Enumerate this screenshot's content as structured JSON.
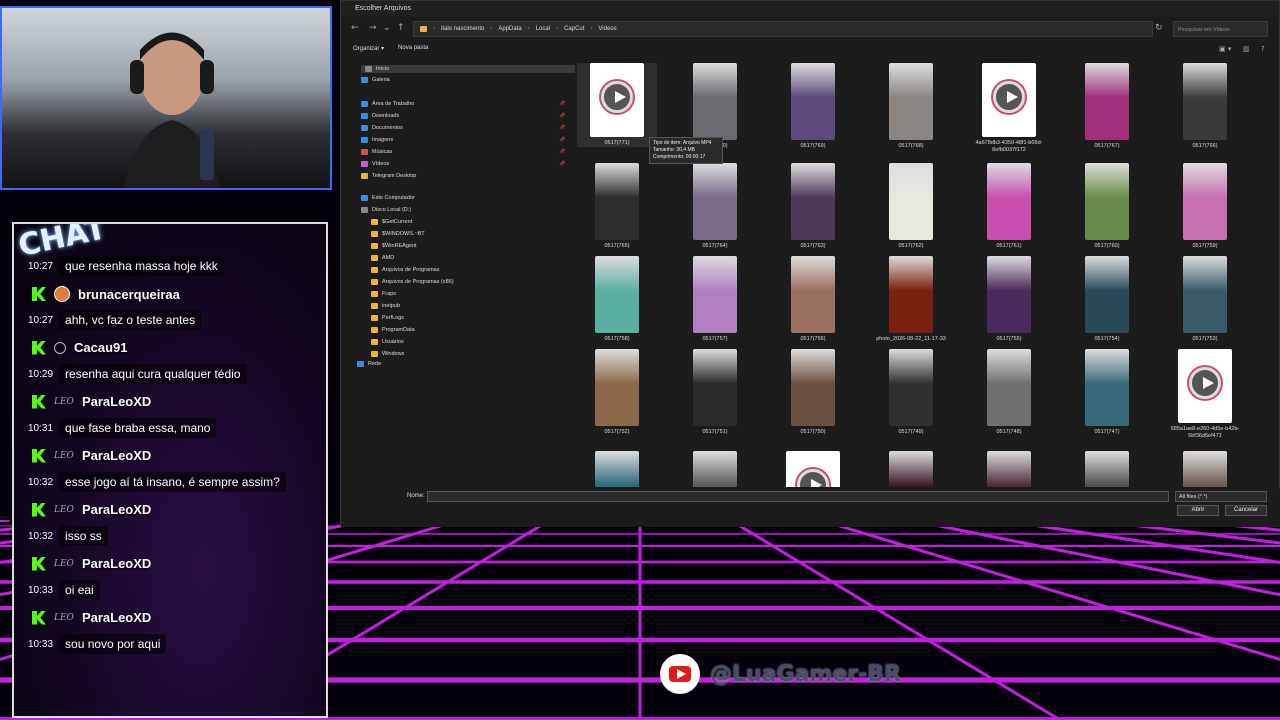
{
  "chat": {
    "badge": "CHAT",
    "messages": [
      {
        "time": "10:27",
        "text": "que resenha massa hoje kkk"
      },
      {
        "user": "brunacerqueiraa",
        "time": "10:27",
        "text": "ahh, vc faz o teste antes"
      },
      {
        "user": "Cacau91",
        "time": "10:29",
        "text": "resenha aqui cura qualquer tédio"
      },
      {
        "user": "ParaLeoXD",
        "tag": "LEO",
        "time": "10:31",
        "text": "que fase braba essa, mano"
      },
      {
        "user": "ParaLeoXD",
        "tag": "LEO",
        "time": "10:32",
        "text": "esse jogo aí tá insano, é sempre assim?"
      },
      {
        "user": "ParaLeoXD",
        "tag": "LEO",
        "time": "10:32",
        "text": "isso ss"
      },
      {
        "user": "ParaLeoXD",
        "tag": "LEO",
        "time": "10:33",
        "text": "oi eai"
      },
      {
        "user": "ParaLeoXD",
        "tag": "LEO",
        "time": "10:33",
        "text": "sou novo por aqui"
      }
    ]
  },
  "dialog": {
    "title": "Escolher Arquivos",
    "path": [
      "italo nascimento",
      "AppData",
      "Local",
      "CapCut",
      "Videos"
    ],
    "search_placeholder": "Pesquisar em Videos",
    "toolbar": {
      "organize": "Organizar ▾",
      "new_folder": "Nova pasta"
    },
    "nav": [
      {
        "label": "Início",
        "icon": "home-icon"
      },
      {
        "label": "Galeria",
        "icon": "gallery-icon"
      },
      {
        "label": "Área de Trabalho",
        "icon": "desktop-icon"
      },
      {
        "label": "Downloads",
        "icon": "download-icon"
      },
      {
        "label": "Documentos",
        "icon": "documents-icon"
      },
      {
        "label": "Imagens",
        "icon": "pictures-icon"
      },
      {
        "label": "Músicas",
        "icon": "music-icon"
      },
      {
        "label": "Vídeos",
        "icon": "videos-icon"
      },
      {
        "label": "Telegram Desktop",
        "icon": "folder-icon"
      },
      {
        "label": "Este Computador",
        "icon": "computer-icon"
      },
      {
        "label": "Disco Local (D:)",
        "icon": "drive-icon"
      },
      {
        "label": "$GetCurrent",
        "icon": "folder-icon"
      },
      {
        "label": "$WINDOWS.~BT",
        "icon": "folder-icon"
      },
      {
        "label": "$WinREAgent",
        "icon": "folder-icon"
      },
      {
        "label": "AMD",
        "icon": "folder-icon"
      },
      {
        "label": "Arquivos de Programas",
        "icon": "folder-icon"
      },
      {
        "label": "Arquivos de Programas (x86)",
        "icon": "folder-icon"
      },
      {
        "label": "Fraps",
        "icon": "folder-icon"
      },
      {
        "label": "inetpub",
        "icon": "folder-icon"
      },
      {
        "label": "PerfLogs",
        "icon": "folder-icon"
      },
      {
        "label": "ProgramData",
        "icon": "folder-icon"
      },
      {
        "label": "Usuários",
        "icon": "folder-icon"
      },
      {
        "label": "Windows",
        "icon": "folder-icon"
      },
      {
        "label": "Rede",
        "icon": "network-icon"
      }
    ],
    "files": [
      {
        "name": "0517(771)",
        "kind": "doc"
      },
      {
        "name": "0517(770)",
        "kind": "img",
        "color": "#6a6a70"
      },
      {
        "name": "0517(769)",
        "kind": "img",
        "color": "#5b4a7a"
      },
      {
        "name": "0517(768)",
        "kind": "img",
        "color": "#8a8580"
      },
      {
        "name": "4a678db3-4350-48f1-b09d-8efb0037f172",
        "kind": "doc"
      },
      {
        "name": "0517(767)",
        "kind": "img",
        "color": "#a0307a"
      },
      {
        "name": "0517(766)",
        "kind": "img",
        "color": "#3a3a3a"
      },
      {
        "name": "0517(765)",
        "kind": "img",
        "color": "#2c2c2c"
      },
      {
        "name": "0517(764)",
        "kind": "img",
        "color": "#7a6a8a"
      },
      {
        "name": "0517(763)",
        "kind": "img",
        "color": "#503a5a"
      },
      {
        "name": "0517(762)",
        "kind": "img",
        "color": "#e8e8e0"
      },
      {
        "name": "0517(761)",
        "kind": "img",
        "color": "#c84fb0"
      },
      {
        "name": "0517(760)",
        "kind": "img",
        "color": "#6a8a4a"
      },
      {
        "name": "0517(759)",
        "kind": "img",
        "color": "#c86fb0"
      },
      {
        "name": "0517(758)",
        "kind": "img",
        "color": "#5ab0a0"
      },
      {
        "name": "0517(757)",
        "kind": "img",
        "color": "#b080c0"
      },
      {
        "name": "0517(756)",
        "kind": "img",
        "color": "#9a7060"
      },
      {
        "name": "photo_2026-08-22_11-17-33",
        "kind": "img",
        "color": "#7a2010"
      },
      {
        "name": "0517(755)",
        "kind": "img",
        "color": "#4a2a5a"
      },
      {
        "name": "0517(754)",
        "kind": "img",
        "color": "#2a4a5a"
      },
      {
        "name": "0517(753)",
        "kind": "img",
        "color": "#3a5a6a"
      },
      {
        "name": "0517(752)",
        "kind": "img",
        "color": "#8a6a4a"
      },
      {
        "name": "0517(751)",
        "kind": "img",
        "color": "#2a2a2a"
      },
      {
        "name": "0517(750)",
        "kind": "img",
        "color": "#6a5040"
      },
      {
        "name": "0517(749)",
        "kind": "img",
        "color": "#303030"
      },
      {
        "name": "0517(748)",
        "kind": "img",
        "color": "#707070"
      },
      {
        "name": "0517(747)",
        "kind": "img",
        "color": "#3a6a7a"
      },
      {
        "name": "685a1ae8-e260-4d5e-b42b-5bf36d6ef471",
        "kind": "doc"
      },
      {
        "name": "",
        "kind": "img",
        "color": "#2a6a7a"
      },
      {
        "name": "",
        "kind": "img",
        "color": "#5a5a5a"
      },
      {
        "name": "",
        "kind": "doc"
      },
      {
        "name": "",
        "kind": "img",
        "color": "#3a1a2a"
      },
      {
        "name": "",
        "kind": "img",
        "color": "#4a2a3a"
      },
      {
        "name": "",
        "kind": "img",
        "color": "#505050"
      },
      {
        "name": "",
        "kind": "img",
        "color": "#6a5a50"
      }
    ],
    "tooltip": [
      "Tipo de item: Arquivo MP4",
      "Tamanho: 30,4 MB",
      "Comprimento: 00:00:17"
    ],
    "name_label": "Nome:",
    "name_value": "",
    "filter": "All files (*.*)",
    "open_button": "Abrir",
    "cancel_button": "Cancelar"
  },
  "youtube": {
    "handle": "@LuaGamer-BR"
  },
  "colors": {
    "grid": "#c21fe0",
    "kick": "#53fc18",
    "cam_border": "#3b6df0"
  }
}
